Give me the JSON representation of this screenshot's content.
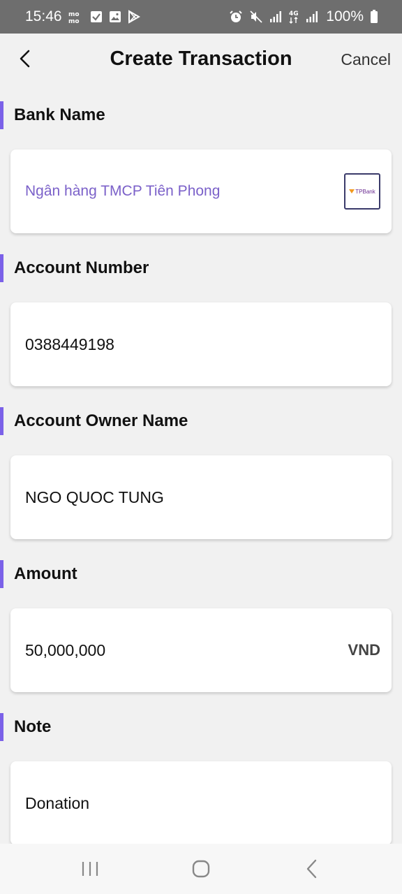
{
  "status_bar": {
    "time": "15:46",
    "battery": "100%",
    "left_icons": [
      "momo-icon",
      "check-square-icon",
      "image-icon",
      "play-store-icon"
    ],
    "right_icons": [
      "alarm-icon",
      "mute-icon",
      "signal-icon",
      "4g-data-icon",
      "signal-icon"
    ]
  },
  "header": {
    "title": "Create Transaction",
    "cancel_label": "Cancel"
  },
  "form": {
    "bank_name": {
      "label": "Bank Name",
      "value": "Ngân hàng TMCP Tiên Phong",
      "logo_text": "TPBank"
    },
    "account_number": {
      "label": "Account Number",
      "value": "0388449198"
    },
    "account_owner": {
      "label": "Account Owner Name",
      "value": "NGO QUOC TUNG"
    },
    "amount": {
      "label": "Amount",
      "value": "50,000,000",
      "currency": "VND"
    },
    "note": {
      "label": "Note",
      "value": "Donation"
    }
  },
  "colors": {
    "accent": "#7b61e8",
    "status_bar": "#6e6e6e",
    "background": "#f1f1f1"
  }
}
